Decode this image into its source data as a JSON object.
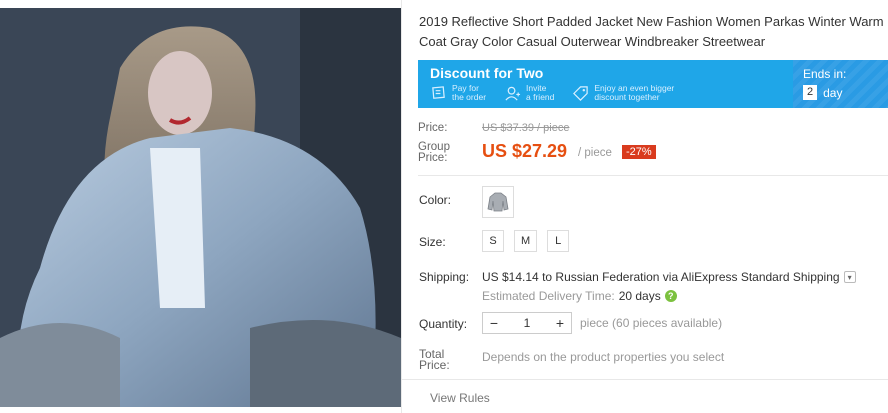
{
  "product": {
    "title": "2019 Reflective Short Padded Jacket New Fashion Women Parkas Winter Warm Coat Gray Color Casual Outerwear Windbreaker Streetwear",
    "photo_alt": "woman wearing reflective gray jacket"
  },
  "banner": {
    "title": "Discount for Two",
    "steps": [
      {
        "icon": "cart-icon",
        "text": "Pay for\nthe order"
      },
      {
        "icon": "person-invite-icon",
        "text": "Invite\na friend"
      },
      {
        "icon": "tag-icon",
        "text": "Enjoy an even bigger\ndiscount together"
      }
    ],
    "ends_label": "Ends in:",
    "ends_value": "2",
    "ends_unit": "day"
  },
  "price": {
    "price_label": "Price:",
    "old_price": "US $37.39 / piece",
    "group_label_1": "Group",
    "group_label_2": "Price:",
    "new_price": "US $27.29",
    "per_piece": "/ piece",
    "discount": "-27%"
  },
  "color": {
    "label": "Color:"
  },
  "size": {
    "label": "Size:",
    "options": [
      "S",
      "M",
      "L"
    ]
  },
  "shipping": {
    "label": "Shipping:",
    "cost": "US $14.14",
    "text": "to Russian Federation via AliExpress Standard Shipping",
    "est_label": "Estimated Delivery Time:",
    "est_value": "20 days",
    "help": "?"
  },
  "quantity": {
    "label": "Quantity:",
    "minus": "−",
    "value": "1",
    "plus": "+",
    "available": "piece (60 pieces available)"
  },
  "total": {
    "label_1": "Total",
    "label_2": "Price:",
    "note": "Depends on the product properties you select"
  },
  "footer": {
    "view_rules": "View Rules"
  },
  "colors": {
    "accent_orange": "#e64f11",
    "banner_blue": "#1fa6e8",
    "badge_red": "#d93b1e",
    "help_green": "#7cc13f"
  }
}
